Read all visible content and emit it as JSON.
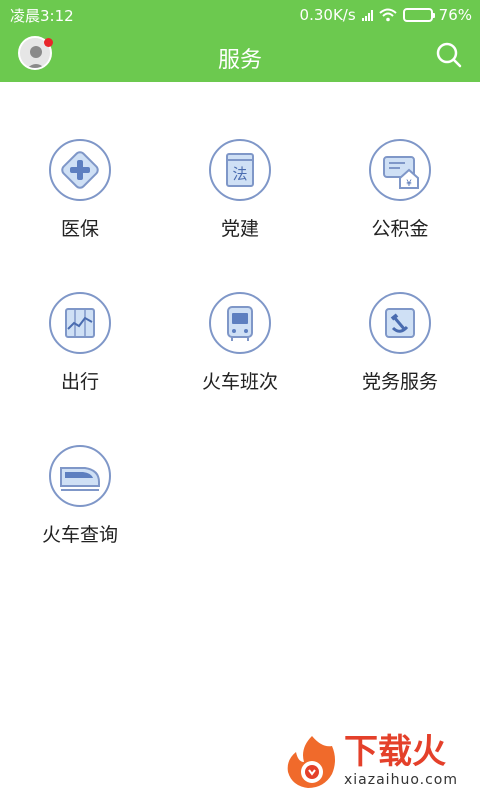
{
  "status_bar": {
    "time": "凌晨3:12",
    "network_speed": "0.30K/s",
    "battery": "76%",
    "battery_level": 0.76
  },
  "header": {
    "title": "服务"
  },
  "services": [
    {
      "label": "医保",
      "icon": "medical-insurance-icon"
    },
    {
      "label": "党建",
      "icon": "party-building-icon"
    },
    {
      "label": "公积金",
      "icon": "housing-fund-icon"
    },
    {
      "label": "出行",
      "icon": "travel-icon"
    },
    {
      "label": "火车班次",
      "icon": "bus-icon"
    },
    {
      "label": "党务服务",
      "icon": "party-affairs-icon"
    },
    {
      "label": "火车查询",
      "icon": "train-query-icon"
    }
  ],
  "icon_glyphs": {
    "party-building": "法",
    "housing-fund": "¥"
  },
  "watermark": {
    "brand": "下载火",
    "url": "xiazaihuo.com"
  },
  "colors": {
    "header_green": "#6cc94f",
    "icon_outline": "#7f97c8",
    "icon_fill": "#cfe0f5",
    "watermark_red": "#e4402a"
  }
}
